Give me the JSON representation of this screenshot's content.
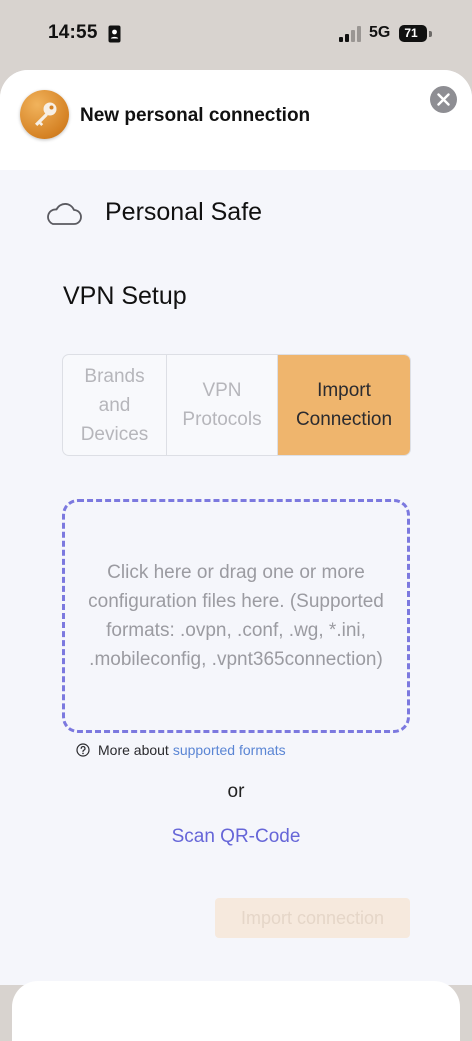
{
  "status": {
    "time": "14:55",
    "network": "5G",
    "battery": "71"
  },
  "header": {
    "title": "New personal connection"
  },
  "section": {
    "title": "Personal Safe"
  },
  "setup": {
    "title": "VPN Setup",
    "tabs": [
      {
        "label": "Brands and Devices",
        "active": false
      },
      {
        "label": "VPN Protocols",
        "active": false
      },
      {
        "label": "Import Connection",
        "active": true
      }
    ]
  },
  "dropzone": {
    "text": "Click here or drag one or more configuration files here. (Supported formats: .ovpn, .conf, .wg, *.ini, .mobileconfig, .vpnt365connection)"
  },
  "help": {
    "prefix": "More about",
    "link": "supported formats"
  },
  "or_text": "or",
  "scan_link": "Scan QR-Code",
  "import_button": {
    "label": "Import connection",
    "enabled": false
  },
  "colors": {
    "accent": "#efb56d",
    "link": "#6666d8",
    "dropzone_border": "#7c79df",
    "background": "#f5f6fb"
  },
  "icons": {
    "app": "key-icon",
    "close": "close-icon",
    "section": "cloud-icon",
    "help": "question-circle-icon"
  }
}
